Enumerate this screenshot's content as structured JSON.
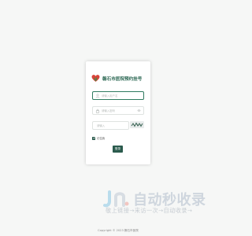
{
  "app": {
    "title": "磐石市医院预约挂号",
    "logo_icon": "heart-leaf-logo-icon",
    "brand_color": "#2f6a56"
  },
  "form": {
    "username_placeholder": "请输入用户名",
    "password_placeholder": "请输入密码",
    "captcha_placeholder": "请输入",
    "captcha_text": "x7A",
    "remember_label": "记住我",
    "remember_checked": true,
    "login_button": "登录"
  },
  "watermark": {
    "brand": "自动秒收录",
    "slogan": "敬上链接→来访一次→自动收录→"
  },
  "footer": {
    "copyright": "Copyright © 2023 磐石市医院"
  }
}
